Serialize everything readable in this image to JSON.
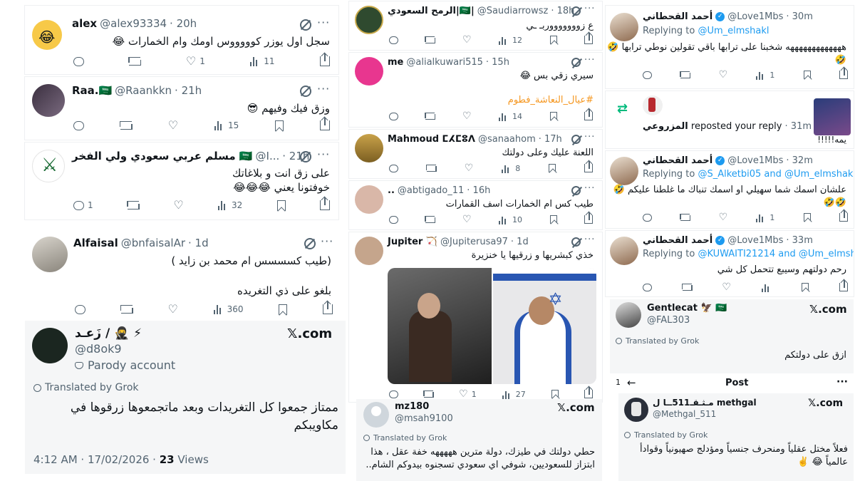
{
  "col1": {
    "t1": {
      "name": "alex",
      "handle": "@alex93334",
      "time": "· 20h",
      "text": "سجل اول يوزر كوووووس اومك وام الخمارات 😂",
      "likes": "1",
      "views": "11"
    },
    "t2": {
      "name": "Raa.🇸🇦",
      "handle": "@Raankkn",
      "time": "· 21h",
      "text": "وزق فيك وفيهم 😎",
      "views": "15"
    },
    "t3": {
      "name": "مسلم عربي سعودي ولي الفخر 🇸🇦",
      "handle": "@I...",
      "time": "· 21h",
      "text1": "على زق انت و بلاغاتك",
      "text2": "خوفتونا يعني 😂😂😂",
      "replies": "1",
      "views": "32"
    },
    "t4": {
      "name": "Alfaisal",
      "handle": "@bnfaisalAr",
      "time": "· 1d",
      "text1": "(طيب كسسسس ام محمد بن زايد )",
      "text2": "بلغو على ذي التغريده",
      "views": "360"
    },
    "t5": {
      "name": "زَعـد / 🥷 ⚡",
      "handle": "@d8ok9",
      "parody": "Parody account",
      "translated": "Translated by Grok",
      "text": "ممتاز جمعوا كل التغريدات وبعد ماتجمعوها زرقوها في مكاويبكم",
      "date": "4:12 AM · 17/02/2026 · ",
      "views_count": "23",
      "views_label": " Views",
      "xlogo": "𝕏.com"
    }
  },
  "col2": {
    "t1": {
      "name": "الرمح السعودي|🇸🇦|",
      "handle": "@Saudiarrowsz",
      "time": "· 18h",
      "text": "ع زوووووووربـ ـي",
      "views": "12"
    },
    "t2": {
      "name": "me",
      "handle": "@alialkuwari515",
      "time": "· 15h",
      "text": "سيري زقي بس 😂",
      "hashtag": "#عيال_النعاشة_فطوم",
      "views": "14"
    },
    "t3": {
      "name": "Mahmoud ⵎⵃⵎⵓⴷ",
      "handle": "@sanaahom",
      "time": "· 17h",
      "text": "اللعنة عليك وعلى دولتك",
      "views": "8"
    },
    "t4": {
      "name": "..",
      "handle": "@abtigado_11",
      "time": "· 16h",
      "text": "طيب كس ام الخمارات اسف القمارات",
      "views": "10"
    },
    "t5": {
      "name": "Jupiter 🏹",
      "handle": "@Jupiterusa97",
      "time": "· 1d",
      "text": "خذي كبشريها و زرقيها يا خنزيرة",
      "likes": "1",
      "views": "27"
    },
    "t6": {
      "name": "mz180",
      "handle": "@msah9100",
      "translated": "Translated by Grok",
      "xlogo": "𝕏.com",
      "text": "حطي دولتك في طيزك، دولة مترين هههههه خفة عقل ، هذا ابتزاز للسعوديين، شوفي اي سعودي تسجنوه بيدوكم الشام.."
    }
  },
  "col3": {
    "t1": {
      "name": "أحمد القحطاني",
      "handle": "@Love1Mbs",
      "time": "· 30m",
      "replying": "Replying to",
      "replyto": "@Um_elmshakl",
      "text": "هههههههههههههه شخبنا على ترابها باقي تقولين نوطي ترابها 🤣🤣",
      "likes": "1"
    },
    "t2": {
      "name": "المزروعي",
      "label": "reposted your reply",
      "time": "· 31m",
      "text": "يمه!!!!!"
    },
    "t3": {
      "name": "أحمد القحطاني",
      "handle": "@Love1Mbs",
      "time": "· 32m",
      "replying": "Replying to",
      "replyto": "@S_Alketbi05 and @Um_elmshakl",
      "text": "علشان اسمك شما سهيلي او اسمك تنباك ما غلطنا عليكم 🤣🤣🤣",
      "likes": "1"
    },
    "t4": {
      "name": "أحمد القحطاني",
      "handle": "@Love1Mbs",
      "time": "· 33m",
      "replying": "Replying to",
      "replyto": "@KUWAITI21214 and @Um_elmshakl",
      "text": "رحم دولتهم وسيبع تتحمل كل شي"
    },
    "t5": {
      "name": "Gentlecat 🦅 🇸🇦",
      "handle": "@FAL303",
      "translated": "Translated by Grok",
      "text": "ازق على دولتكم",
      "xlogo": "𝕏.com"
    },
    "t6": {
      "num": "1",
      "back": "←",
      "post": "Post",
      "dots": "···",
      "name": "مـثـقـ511ــا ل methgal",
      "handle": "@Methgal_511",
      "translated": "Translated by Grok",
      "xlogo": "𝕏.com",
      "text": "فعلاً مختل عقلياً ومنحرف جنسياً ومؤدلج صهيونياً وقوادأ عالمياً 😂 ✌️"
    }
  },
  "icons": {
    "reply": "reply-icon",
    "retweet": "retweet-icon",
    "like": "heart-icon",
    "views": "views-icon",
    "bookmark": "bookmark-icon",
    "share": "share-icon"
  }
}
